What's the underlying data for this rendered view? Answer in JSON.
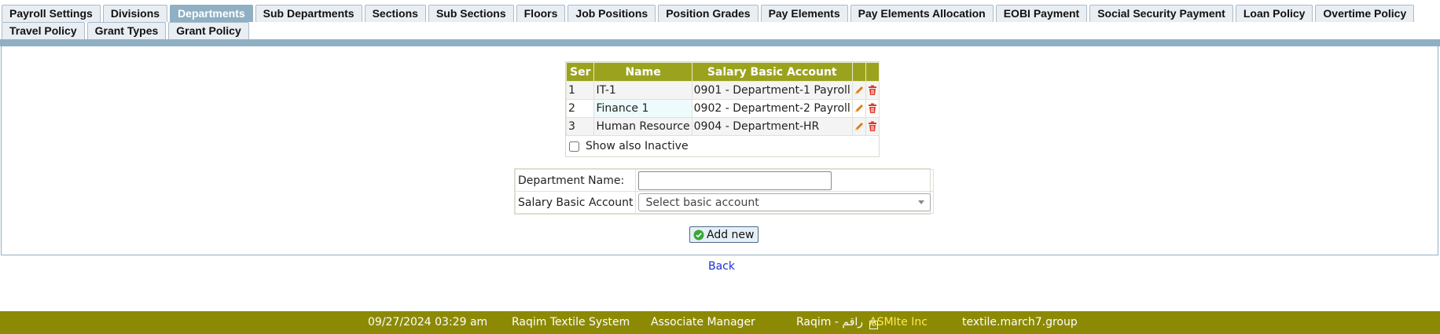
{
  "tabs": {
    "row1": [
      "Payroll Settings",
      "Divisions",
      "Departments",
      "Sub Departments",
      "Sections",
      "Sub Sections",
      "Floors",
      "Job Positions",
      "Position Grades",
      "Pay Elements",
      "Pay Elements Allocation",
      "EOBI Payment",
      "Social Security Payment",
      "Loan Policy",
      "Overtime Policy"
    ],
    "row2": [
      "Travel Policy",
      "Grant Types",
      "Grant Policy"
    ],
    "active": "Departments"
  },
  "grid": {
    "headers": {
      "ser": "Ser",
      "name": "Name",
      "account": "Salary Basic Account"
    },
    "rows": [
      {
        "ser": "1",
        "name": "IT-1",
        "account": "0901 - Department-1 Payroll"
      },
      {
        "ser": "2",
        "name": "Finance 1",
        "account": "0902 - Department-2 Payroll"
      },
      {
        "ser": "3",
        "name": "Human Resource",
        "account": "0904 - Department-HR"
      }
    ],
    "show_inactive_label": "Show also Inactive"
  },
  "form": {
    "department_name_label": "Department Name:",
    "department_name_value": "",
    "salary_account_label": "Salary Basic Account",
    "salary_account_selected": "Select basic account",
    "add_button_label": "Add new"
  },
  "back_label": "Back",
  "footer": {
    "datetime": "09/27/2024 03:29 am",
    "system": "Raqim Textile System",
    "role": "Associate Manager",
    "product": "Raqim - راقم",
    "company": "ASMIte Inc",
    "domain": "textile.march7.group"
  },
  "colors": {
    "tab_active": "#8fb0c4",
    "grid_header": "#9ba31e",
    "footer_bg": "#8c8a05",
    "footer_brand": "#ffe94a",
    "edit_icon": "#e07b10",
    "delete_icon": "#e03a2a",
    "link": "#1a33cc"
  }
}
